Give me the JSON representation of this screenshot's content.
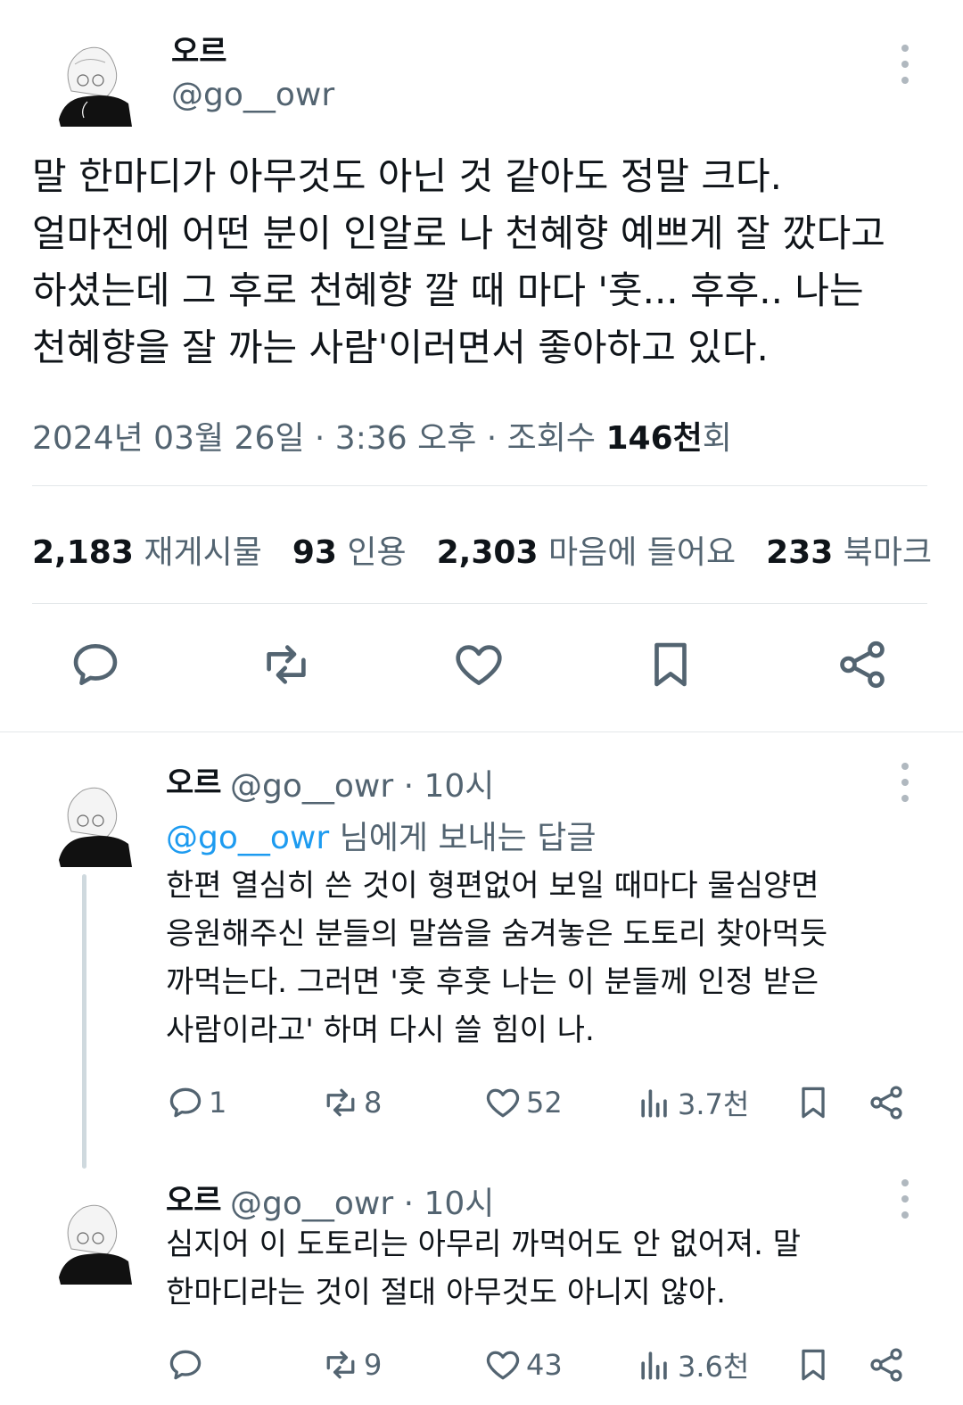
{
  "main_tweet": {
    "display_name": "오르",
    "handle": "@go__owr",
    "text": "말 한마디가 아무것도 아닌 것 같아도 정말 크다.\n얼마전에 어떤 분이 인알로 나 천혜향 예쁘게 잘 깠다고\n하셨는데 그 후로 천혜향 깔 때 마다 '훗... 후후.. 나는\n천혜향을 잘 까는 사람'이러면서 좋아하고 있다.",
    "date_time": "2024년 03월 26일 · 3:36 오후 · 조회수 ",
    "views_bold": "146천",
    "views_suffix": "회",
    "stats": {
      "reposts_count": "2,183",
      "reposts_label": "재게시물",
      "quotes_count": "93",
      "quotes_label": "인용",
      "likes_count": "2,303",
      "likes_label": "마음에 들어요",
      "bookmarks_count": "233",
      "bookmarks_label": "북마크"
    }
  },
  "replies": [
    {
      "display_name": "오르",
      "handle_time": "@go__owr · 10시",
      "reply_to_mention": "@go__owr",
      "reply_to_suffix": " 님에게 보내는 답글",
      "text": "한편 열심히 쓴 것이 형편없어 보일 때마다 물심양면\n응원해주신 분들의 말씀을 숨겨놓은 도토리 찾아먹듯\n까먹는다. 그러면 '훗 후훗 나는 이 분들께 인정 받은\n사람이라고' 하며 다시 쓸 힘이 나.",
      "replies": "1",
      "reposts": "8",
      "likes": "52",
      "views": "3.7천"
    },
    {
      "display_name": "오르",
      "handle_time": "@go__owr · 10시",
      "text": "심지어 이 도토리는 아무리 까먹어도 안 없어져. 말\n한마디라는 것이 절대 아무것도 아니지 않아.",
      "replies": "",
      "reposts": "9",
      "likes": "43",
      "views": "3.6천"
    }
  ],
  "colors": {
    "text_primary": "#0f1419",
    "text_secondary": "#536471",
    "mention": "#1d9bf0",
    "divider": "#e3e7ea"
  },
  "icons": [
    "reply-icon",
    "repost-icon",
    "like-icon",
    "bookmark-icon",
    "share-icon",
    "views-icon",
    "more-icon"
  ]
}
